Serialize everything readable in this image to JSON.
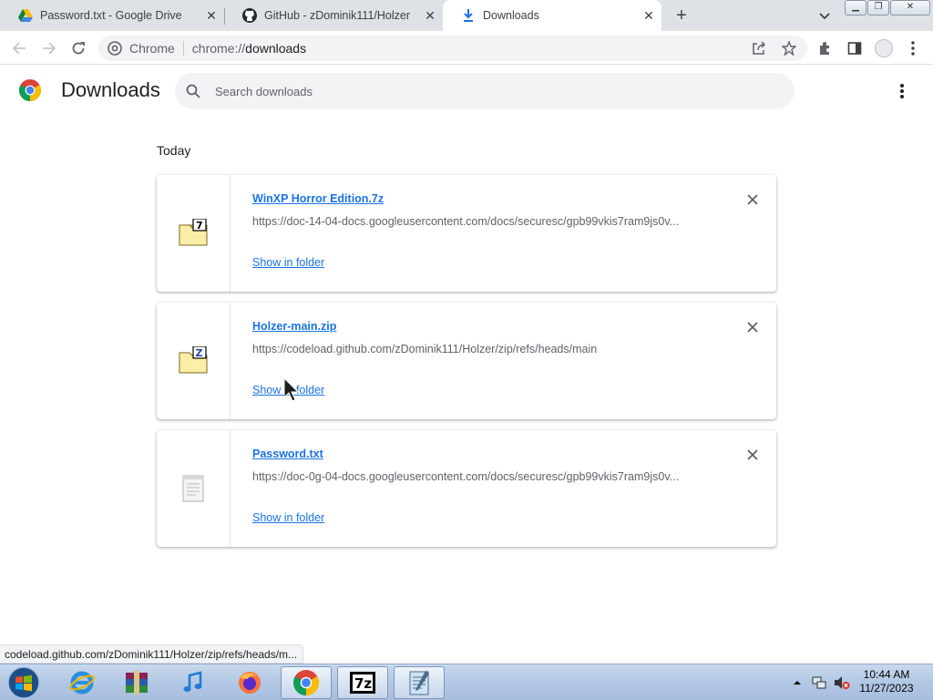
{
  "tabs": [
    {
      "title": "Password.txt - Google Drive",
      "icon": "google-drive-icon"
    },
    {
      "title": "GitHub - zDominik111/Holzer",
      "icon": "github-icon"
    },
    {
      "title": "Downloads",
      "icon": "download-icon",
      "active": true
    }
  ],
  "omnibox": {
    "site_label": "Chrome",
    "url_scheme": "chrome://",
    "url_host": "downloads"
  },
  "downloads_page": {
    "title": "Downloads",
    "search_placeholder": "Search downloads",
    "date_heading": "Today",
    "items": [
      {
        "name": "WinXP Horror Edition.7z",
        "url": "https://doc-14-04-docs.googleusercontent.com/docs/securesc/gpb99vkis7ram9js0v...",
        "action": "Show in folder",
        "icon": "7z-archive-icon"
      },
      {
        "name": "Holzer-main.zip",
        "url": "https://codeload.github.com/zDominik111/Holzer/zip/refs/heads/main",
        "action": "Show in folder",
        "icon": "zip-archive-icon"
      },
      {
        "name": "Password.txt",
        "url": "https://doc-0g-04-docs.googleusercontent.com/docs/securesc/gpb99vkis7ram9js0v...",
        "action": "Show in folder",
        "icon": "text-file-icon"
      }
    ]
  },
  "status_bar": "codeload.github.com/zDominik111/Holzer/zip/refs/heads/m...",
  "taskbar": {
    "apps": [
      "internet-explorer",
      "winrar",
      "itunes",
      "firefox",
      "chrome",
      "7-zip",
      "notepad"
    ],
    "clock_time": "10:44 AM",
    "clock_date": "11/27/2023"
  },
  "colors": {
    "link": "#1a73e8",
    "tabstrip": "#dee1e6",
    "omnibox": "#f1f3f4"
  }
}
